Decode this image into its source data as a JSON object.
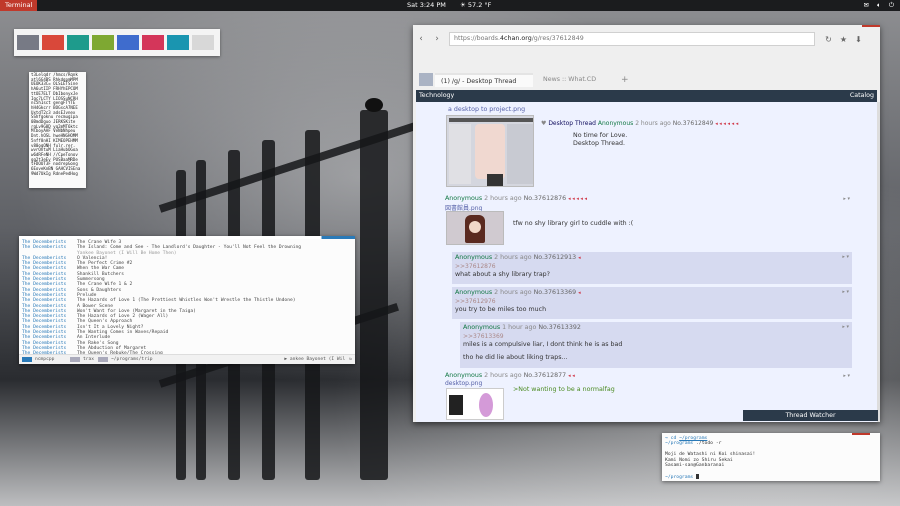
{
  "panel": {
    "app_name": "Terminal",
    "clock": "Sat  3:24 PM",
    "weather": "☀ 57.2 °F",
    "tray_icons": [
      "mail-icon",
      "volume-icon",
      "power-icon"
    ]
  },
  "palette": {
    "colors": [
      "#777a85",
      "#d9483a",
      "#1e9b8c",
      "#7ea832",
      "#3f6ccd",
      "#d4365a",
      "#1a95b0",
      "#d8d8d8"
    ]
  },
  "hashbox": {
    "lines": [
      "t3Lelqdr /hmcs/Rqnk",
      "atl6G4BS RhkdgpmMPM",
      "UEOK33C= OLSLETSine",
      "hA6utIIP FRHYhEPCOM",
      "ttOE7ELT DbIbonyxJe",
      "Igc7LCTY LIOSSuNCRH",
      "nc5h1sct gengFTYTE",
      "hH4Gkcrr BOGscA7NEE",
      "UxtdT2c3 adsEJvnex",
      "SShfgoknu recmugipa",
      "0BmdDguo JERKSKite",
      "rqLv9G8D yq2mMT6ktc",
      "MlboyAAF VeNbNhpeu",
      "Dnt.hOSL hweHNGHOMM",
      "5nff8nHI KIMEOPEHMM",
      "v80oqONH fulr.rer.",
      "wvrOhtuM LiaHubOGoa",
      "w6dRFeNH //CpeTonov",
      "gq2t3eEv PUSBaaMRDe",
      "tFDOUT3F nodrepGong",
      "6EoveKnBN GAHCVISEna",
      "9Wd7UkIg RdnePedHog"
    ]
  },
  "music": {
    "accent_color": "#2a7ab8",
    "rows": [
      {
        "artist": "The Decemberists",
        "track": "The Crane Wife 3",
        "selected": false
      },
      {
        "artist": "The Decemberists",
        "track": "The Island: Come and See - The Landlord's Daughter - You'll Not Feel the Drowning",
        "selected": false
      },
      {
        "artist": "",
        "track": "Yankee Bayonet (I Will Be Home Then)",
        "selected": true
      },
      {
        "artist": "The Decemberists",
        "track": "O Valencia!",
        "selected": false
      },
      {
        "artist": "The Decemberists",
        "track": "The Perfect Crime #2",
        "selected": false
      },
      {
        "artist": "The Decemberists",
        "track": "When the War Came",
        "selected": false
      },
      {
        "artist": "The Decemberists",
        "track": "Shankill Butchers",
        "selected": false
      },
      {
        "artist": "The Decemberists",
        "track": "Summersong",
        "selected": false
      },
      {
        "artist": "The Decemberists",
        "track": "The Crane Wife 1 & 2",
        "selected": false
      },
      {
        "artist": "The Decemberists",
        "track": "Sons & Daughters",
        "selected": false
      },
      {
        "artist": "The Decemberists",
        "track": "Prelude",
        "selected": false
      },
      {
        "artist": "The Decemberists",
        "track": "The Hazards of Love 1 (The Prettiest Whistles Won't Wrestle the Thistle Undone)",
        "selected": false
      },
      {
        "artist": "The Decemberists",
        "track": "A Bower Scene",
        "selected": false
      },
      {
        "artist": "The Decemberists",
        "track": "Won't Want for Love (Margaret in the Taiga)",
        "selected": false
      },
      {
        "artist": "The Decemberists",
        "track": "The Hazards of Love 2 (Wager All)",
        "selected": false
      },
      {
        "artist": "The Decemberists",
        "track": "The Queen's Approach",
        "selected": false
      },
      {
        "artist": "The Decemberists",
        "track": "Isn't It a Lovely Night?",
        "selected": false
      },
      {
        "artist": "The Decemberists",
        "track": "The Wanting Comes in Waves/Repaid",
        "selected": false
      },
      {
        "artist": "The Decemberists",
        "track": "An Interlude",
        "selected": false
      },
      {
        "artist": "The Decemberists",
        "track": "The Rake's Song",
        "selected": false
      },
      {
        "artist": "The Decemberists",
        "track": "The Abduction of Margaret",
        "selected": false
      },
      {
        "artist": "The Decemberists",
        "track": "The Queen's Rebuke/The Crossing",
        "selected": false
      }
    ],
    "status": {
      "mode1": "ncmpcpp",
      "mode2": "trax",
      "path": "~/programs/trip",
      "now_playing": "▶ ankee Bayonet (I Wil"
    }
  },
  "browser": {
    "url_prefix": "https://boards.",
    "url_domain": "4chan.org",
    "url_suffix": "/g/res/37612849",
    "tabs": [
      {
        "label": "(1) /g/ - Desktop Thread",
        "active": true
      },
      {
        "label": "News :: What.CD",
        "active": false
      }
    ],
    "new_tab": "+",
    "board_label": "Technology",
    "catalog_label": "Catalog",
    "thread_watcher": "Thread Watcher",
    "op": {
      "filename": "a desktop to project.png",
      "subject": "Desktop Thread",
      "name": "Anonymous",
      "date": "2 hours ago",
      "no": "No.37612849",
      "body1": "No time for Love.",
      "body2": "Desktop Thread."
    },
    "replies": [
      {
        "name": "Anonymous",
        "date": "2 hours ago",
        "no": "No.37612876",
        "filename": "図書館員.png",
        "quote": "",
        "body": "tfw no shy library girl to cuddle with :(",
        "body2": "",
        "green": false
      },
      {
        "name": "Anonymous",
        "date": "2 hours ago",
        "no": "No.37612913",
        "filename": "",
        "quote": ">>37612876",
        "body": "what about a shy library trap?",
        "body2": "",
        "green": false
      },
      {
        "name": "Anonymous",
        "date": "2 hours ago",
        "no": "No.37613369",
        "filename": "",
        "quote": ">>37612976",
        "body": "you try to be miles too much",
        "body2": "",
        "green": false
      },
      {
        "name": "Anonymous",
        "date": "1 hour ago",
        "no": "No.37613392",
        "filename": "",
        "quote": ">>37613369",
        "body": "miles is a compulsive liar, I dont think he is as bad",
        "body2": "tho he did lie about liking traps...",
        "green": false
      },
      {
        "name": "Anonymous",
        "date": "2 hours ago",
        "no": "No.37612877",
        "filename": "desktop.png",
        "quote": "",
        "body": ">Not wanting to be a normalfag",
        "body2": "",
        "green": true
      }
    ]
  },
  "terminal": {
    "lines": [
      {
        "prompt": "~/programs",
        "text": ""
      },
      {
        "prompt": "~/programs",
        "text": "./todo -r"
      },
      {
        "prompt": "",
        "text": ""
      },
      {
        "prompt": "",
        "text": "Moji de Watashi ni Koi shinasai!"
      },
      {
        "prompt": "",
        "text": "Kami Nomi zo Shiru Sekai"
      },
      {
        "prompt": "",
        "text": "Sasami-san@Ganbaranai"
      },
      {
        "prompt": "",
        "text": ""
      },
      {
        "prompt": "~/programs",
        "text": ""
      }
    ],
    "cd_prefix": "→ cd",
    "cmd_prefix": "→"
  }
}
